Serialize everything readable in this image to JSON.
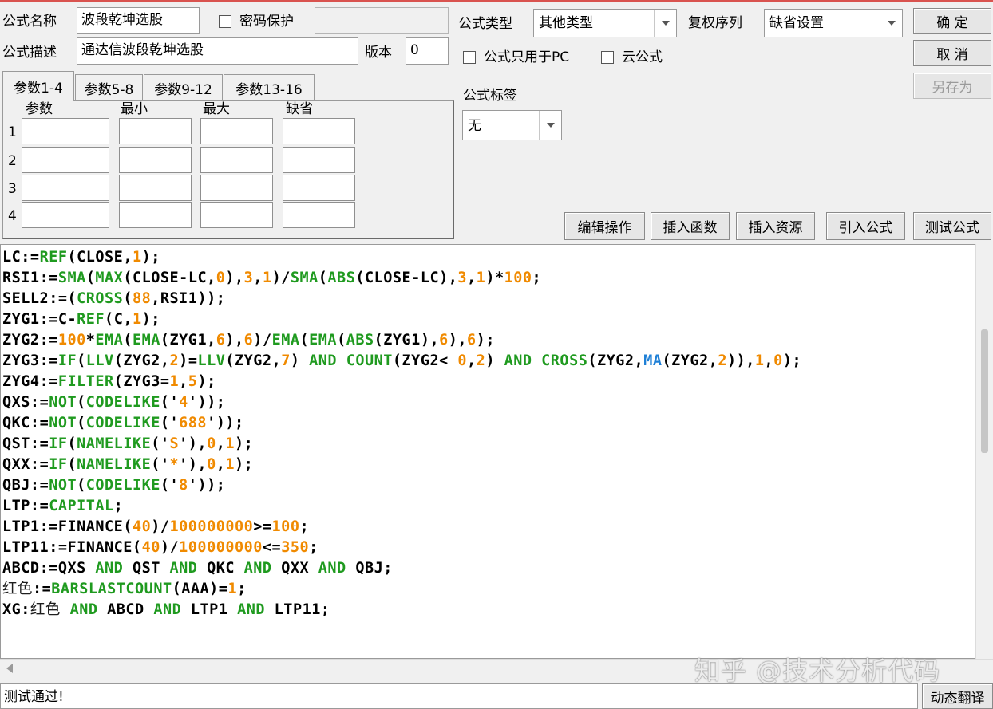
{
  "header": {
    "formula_name_label": "公式名称",
    "formula_name_value": "波段乾坤选股",
    "password_label": "密码保护",
    "formula_desc_label": "公式描述",
    "formula_desc_value": "通达信波段乾坤选股",
    "version_label": "版本",
    "version_value": "0",
    "formula_type_label": "公式类型",
    "formula_type_value": "其他类型",
    "rights_label": "复权序列",
    "rights_value": "缺省设置",
    "pc_only_label": "公式只用于PC",
    "cloud_label": "云公式",
    "tags_label": "公式标签",
    "tags_value": "无"
  },
  "buttons": {
    "ok": "确  定",
    "cancel": "取  消",
    "save_as": "另存为",
    "edit_ops": "编辑操作",
    "insert_func": "插入函数",
    "insert_res": "插入资源",
    "import_formula": "引入公式",
    "test_formula": "测试公式",
    "dynamic_translate": "动态翻译"
  },
  "param_tabs": [
    "参数1-4",
    "参数5-8",
    "参数9-12",
    "参数13-16"
  ],
  "param_columns": [
    "参数",
    "最小",
    "最大",
    "缺省"
  ],
  "param_rows": [
    "1",
    "2",
    "3",
    "4"
  ],
  "code_lines": [
    "LC:=REF(CLOSE,1);",
    "RSI1:=SMA(MAX(CLOSE-LC,0),3,1)/SMA(ABS(CLOSE-LC),3,1)*100;",
    "SELL2:=(CROSS(88,RSI1));",
    "ZYG1:=C-REF(C,1);",
    "ZYG2:=100*EMA(EMA(ZYG1,6),6)/EMA(EMA(ABS(ZYG1),6),6);",
    "ZYG3:=IF(LLV(ZYG2,2)=LLV(ZYG2,7) AND COUNT(ZYG2< 0,2) AND CROSS(ZYG2,MA(ZYG2,2)),1,0);",
    "ZYG4:=FILTER(ZYG3=1,5);",
    "QXS:=NOT(CODELIKE('4'));",
    "QKC:=NOT(CODELIKE('688'));",
    "QST:=IF(NAMELIKE('S'),0,1);",
    "QXX:=IF(NAMELIKE('*'),0,1);",
    "QBJ:=NOT(CODELIKE('8'));",
    "LTP:=CAPITAL;",
    "LTP1:=FINANCE(40)/100000000>=100;",
    "LTP11:=FINANCE(40)/100000000<=350;",
    "ABCD:=QXS AND QST AND QKC AND QXX AND QBJ;",
    "红色:=BARSLASTCOUNT(AAA)=1;",
    "XG:红色 AND ABCD AND LTP1 AND LTP11;"
  ],
  "status_text": "测试通过!",
  "watermark": "知乎 @技术分析代码",
  "colors": {
    "keyword": "#000000",
    "function": "#1f9a1f",
    "number": "#f08a00",
    "special_function": "#1e7fd6",
    "title_accent": "#d9534f"
  },
  "icons": [
    "checkbox-icon",
    "dropdown-arrow-icon",
    "scroll-left-arrow-icon"
  ]
}
